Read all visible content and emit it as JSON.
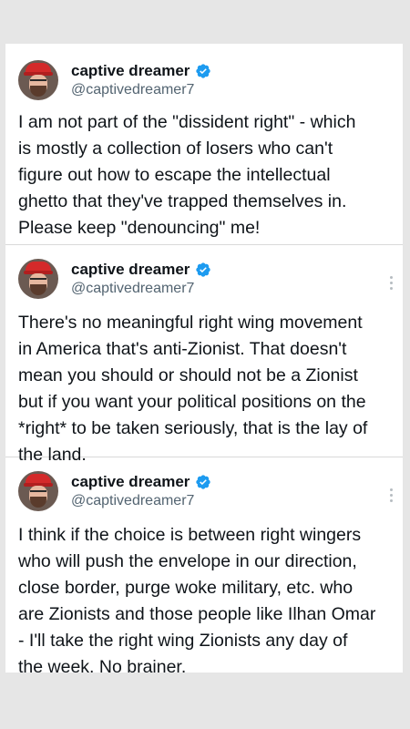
{
  "tweets": [
    {
      "author": {
        "display_name": "captive dreamer",
        "handle": "@captivedreamer7",
        "verified_icon": "verified-badge-icon"
      },
      "text": "I am not part of the \"dissident right\" - which\nis mostly a collection of losers who can't\nfigure out how to escape the intellectual\nghetto that they've trapped themselves in.\nPlease keep \"denouncing\" me!",
      "show_more_menu": false
    },
    {
      "author": {
        "display_name": "captive dreamer",
        "handle": "@captivedreamer7",
        "verified_icon": "verified-badge-icon"
      },
      "text": "There's no meaningful right wing movement\nin America that's anti-Zionist.  That doesn't\nmean you should or should not be a Zionist\nbut if you want your political positions on the\n*right* to be taken seriously, that is the lay of\nthe land.",
      "show_more_menu": true
    },
    {
      "author": {
        "display_name": "captive dreamer",
        "handle": "@captivedreamer7",
        "verified_icon": "verified-badge-icon"
      },
      "text": "I think if the choice is between right wingers\nwho will push the envelope in our direction,\nclose border, purge woke military, etc.  who\nare Zionists and those people like Ilhan Omar\n- I'll take the right wing Zionists any day of\nthe week.  No brainer.",
      "show_more_menu": true
    }
  ],
  "colors": {
    "verified_blue": "#1d9bf0",
    "text_primary": "#0f1419",
    "text_secondary": "#536471"
  }
}
